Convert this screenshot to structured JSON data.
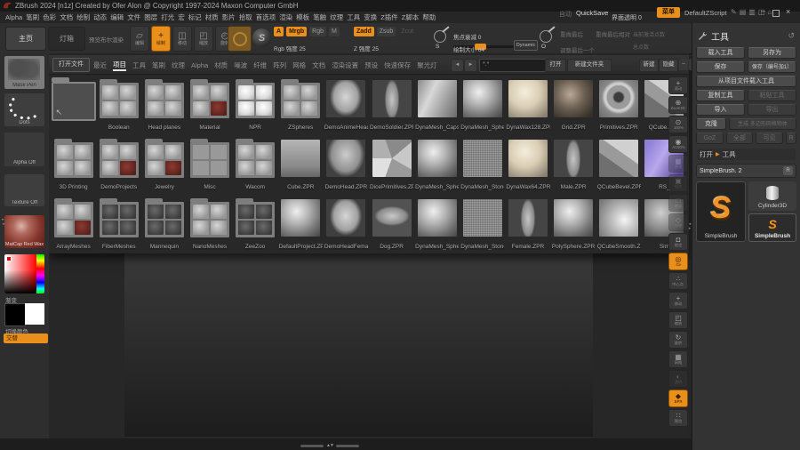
{
  "titlebar": {
    "title": "ZBrush 2024 [n1z] Created by Ofer Alon @ Copyright 1997-2024 Maxon Computer GmbH",
    "auto": "自动",
    "quicksave": "QuickSave",
    "opacity_label": "界面透明 0",
    "menu_btn": "菜单",
    "zscript_btn": "DefaultZScript",
    "icons": [
      "✎",
      "▤",
      "▥",
      "◫",
      "⌂"
    ],
    "minimize": "–",
    "close": "×"
  },
  "menubar": {
    "items": [
      "Alpha",
      "笔刷",
      "色彩",
      "文档",
      "绘制",
      "动态",
      "编辑",
      "文件",
      "图层",
      "打光",
      "宏",
      "标记",
      "材质",
      "影片",
      "拾取",
      "首选项",
      "渲染",
      "模板",
      "笔触",
      "纹理",
      "工具",
      "变换",
      "Z插件",
      "Z脚本",
      "帮助"
    ]
  },
  "topshelf": {
    "home": "主页",
    "lightbox": "灯箱",
    "preview": "预览布尔渲染",
    "modes": [
      {
        "label": "编辑",
        "glyph": "▱",
        "active": false
      },
      {
        "label": "绘制",
        "glyph": "+",
        "active": true
      },
      {
        "label": "移动",
        "glyph": "◫",
        "active": false
      },
      {
        "label": "缩放",
        "glyph": "◰",
        "active": false
      },
      {
        "label": "旋转",
        "glyph": "◴",
        "active": false
      }
    ],
    "brush_s": "S",
    "brush_o": "O",
    "paint": [
      {
        "label": "A",
        "on": true
      },
      {
        "label": "Mrgb",
        "on": true
      },
      {
        "label": "Rgb",
        "on": false
      },
      {
        "label": "M",
        "on": false
      }
    ],
    "rgb_slider": {
      "label": "Rgb 强度 25",
      "pos": 45
    },
    "sculpt": [
      {
        "label": "Zadd",
        "on": true
      },
      {
        "label": "Zsub",
        "on": false
      },
      {
        "label": "Zcut",
        "on": false,
        "disabled": true
      }
    ],
    "z_slider": {
      "label": "Z 强度 25",
      "pos": 78
    },
    "focal_slider": {
      "label": "焦点衰减 0",
      "pos": 38
    },
    "size_slider": {
      "label": "绘制大小 64",
      "pos": 18
    },
    "dynamic": "Dynamic",
    "replay": "重做最后",
    "replay_rel": "重做最后相对",
    "adjust_slider": {
      "label": "调整最后一个",
      "pos": 62
    },
    "active_points": "当前激活点数",
    "total_points": "总点数"
  },
  "leftshelf": {
    "brush": "Mask Pen",
    "stroke": "Dots",
    "alpha": "Alpha Off",
    "texture": "Texture Off",
    "material": "MatCap Red Wax",
    "gradient": "渐变",
    "switch_color": "切换颜色",
    "alternate": "交替"
  },
  "lightbox": {
    "open_file": "打开文件",
    "tabs": [
      {
        "label": "最近",
        "active": false
      },
      {
        "label": "项目",
        "active": true
      },
      {
        "label": "工具",
        "active": false
      },
      {
        "label": "笔刷",
        "active": false
      },
      {
        "label": "纹理",
        "active": false
      },
      {
        "label": "Alpha",
        "active": false
      },
      {
        "label": "材质",
        "active": false
      },
      {
        "label": "噪波",
        "active": false
      },
      {
        "label": "纤维",
        "active": false
      },
      {
        "label": "阵列",
        "active": false
      },
      {
        "label": "网格",
        "active": false
      },
      {
        "label": "文档",
        "active": false
      },
      {
        "label": "渲染设置",
        "active": false
      },
      {
        "label": "预设",
        "active": false
      },
      {
        "label": "快速保存",
        "active": false
      },
      {
        "label": "聚光灯",
        "active": false
      }
    ],
    "prev": "◄",
    "next": "►",
    "filter": "*.*",
    "open": "打开",
    "new_folder": "新建文件夹",
    "new_btn": "新建",
    "hide_btn": "隐藏",
    "view_icons": [
      "–",
      "=",
      "≡",
      "≣"
    ],
    "rows": [
      [
        {
          "label": "",
          "kind": "up"
        },
        {
          "label": "Boolean",
          "kind": "folder"
        },
        {
          "label": "Head planes",
          "kind": "folder"
        },
        {
          "label": "Material",
          "kind": "folder-red"
        },
        {
          "label": "NPR",
          "kind": "folder-light"
        },
        {
          "label": "ZSpheres",
          "kind": "folder"
        },
        {
          "label": "DemoAnimeHead",
          "kind": "head"
        },
        {
          "label": "DemoSoldier.ZPR",
          "kind": "figure"
        },
        {
          "label": "DynaMesh_Capsule",
          "kind": "capsule"
        },
        {
          "label": "DynaMesh_Sphere",
          "kind": "sphere"
        },
        {
          "label": "DynaWax128.ZPR",
          "kind": "wax"
        },
        {
          "label": "Grid.ZPR",
          "kind": "grid-sphere"
        },
        {
          "label": "Primitives.ZPR",
          "kind": "torus"
        },
        {
          "label": "QCube.ZPR",
          "kind": "cube"
        }
      ],
      [
        {
          "label": "3D Printing",
          "kind": "folder"
        },
        {
          "label": "DemoProjects",
          "kind": "folder-red"
        },
        {
          "label": "Jewelry",
          "kind": "folder-red"
        },
        {
          "label": "Misc",
          "kind": "folder-empty"
        },
        {
          "label": "Wacom",
          "kind": "folder"
        },
        {
          "label": "Cube.ZPR",
          "kind": "cube-flat"
        },
        {
          "label": "DemoHead.ZPR",
          "kind": "bust"
        },
        {
          "label": "DicePrimitives.ZPR",
          "kind": "icosa"
        },
        {
          "label": "DynaMesh_Sphere",
          "kind": "sphere"
        },
        {
          "label": "DynaMesh_Stone",
          "kind": "stone"
        },
        {
          "label": "DynaWax64.ZPR",
          "kind": "wax"
        },
        {
          "label": "Male.ZPR",
          "kind": "figure"
        },
        {
          "label": "QCubeBevel.ZPR",
          "kind": "cube"
        },
        {
          "label": "RS_",
          "kind": "purple"
        }
      ],
      [
        {
          "label": "ArrayMeshes",
          "kind": "folder-red"
        },
        {
          "label": "FiberMeshes",
          "kind": "folder-dark"
        },
        {
          "label": "Mannequin",
          "kind": "folder-dark"
        },
        {
          "label": "NanoMeshes",
          "kind": "folder"
        },
        {
          "label": "ZeeZoo",
          "kind": "folder-dark"
        },
        {
          "label": "DefaultProject.ZPR",
          "kind": "sphere"
        },
        {
          "label": "DemoHeadFemale",
          "kind": "head"
        },
        {
          "label": "Dog.ZPR",
          "kind": "dog"
        },
        {
          "label": "DynaMesh_Sphere",
          "kind": "sphere"
        },
        {
          "label": "DynaMesh_Stone",
          "kind": "stone"
        },
        {
          "label": "Female.ZPR",
          "kind": "figure"
        },
        {
          "label": "PolySphere.ZPR",
          "kind": "sphere"
        },
        {
          "label": "QCubeSmooth.ZPR",
          "kind": "cube-smooth"
        },
        {
          "label": "Sim",
          "kind": "sphere-dark"
        }
      ]
    ]
  },
  "right_shelf": [
    {
      "name": "scroll",
      "glyph": "+",
      "label": "滚动"
    },
    {
      "name": "zoom3d",
      "glyph": "⊕",
      "label": "Zoom3D"
    },
    {
      "name": "actual-size",
      "glyph": "⊙",
      "label": "100%"
    },
    {
      "name": "aa-half",
      "glyph": "◉",
      "label": "AC50%"
    },
    {
      "name": "perspective",
      "glyph": "▦",
      "label": "透视",
      "dim": true
    },
    {
      "name": "frame",
      "glyph": "▣",
      "label": "帧合",
      "dim": true
    },
    {
      "name": "floor",
      "glyph": "□",
      "label": "地面",
      "dim": true
    },
    {
      "name": "local-symmetry",
      "glyph": "◇",
      "label": "对称",
      "dim": true
    },
    {
      "name": "lock",
      "glyph": "◘",
      "label": "锁定"
    },
    {
      "name": "gizmo",
      "glyph": "◎",
      "label": "Gv",
      "orange": true
    },
    {
      "name": "pivot",
      "glyph": "∴",
      "label": "中心点"
    },
    {
      "name": "move",
      "glyph": "+",
      "label": "移动"
    },
    {
      "name": "scale",
      "glyph": "◰",
      "label": "缩放"
    },
    {
      "name": "rotate",
      "glyph": "↻",
      "label": "旋转"
    },
    {
      "name": "polyframe",
      "glyph": "▦",
      "label": "网格"
    },
    {
      "name": "transparency",
      "glyph": "◐",
      "label": "透明",
      "dim": true
    },
    {
      "name": "bpr-render",
      "glyph": "◆",
      "label": "BPR",
      "orange": true
    },
    {
      "name": "preview-dots",
      "glyph": "∷",
      "label": "预览"
    }
  ],
  "tool_palette": {
    "title": "工具",
    "load": "载入工具",
    "save_as": "另存为",
    "save": "保存",
    "save_inc": "保存（编号加1）",
    "load_from_project": "从项目文件载入工具",
    "copy": "复制工具",
    "paste": "粘贴工具",
    "import_btn": "导入",
    "export_btn": "导出",
    "clone": "克隆",
    "make_polymesh": "生成 多边形网格物体",
    "goz": "GoZ",
    "all": "全部",
    "visible": "可见",
    "r": "R",
    "section_open": "打开",
    "section_arrow": "▶",
    "section_tool": "工具",
    "current": "SimpleBrush. 2",
    "current_r": "R",
    "logo": "S",
    "thumb_main": "SimpleBrush",
    "thumb_alt": "Cylinder3D",
    "thumb_small": "SimpleBrush"
  },
  "bottom": {
    "arrows": "▲▼"
  },
  "colors": {
    "accent": "#e98f1c",
    "background": "#262626",
    "panel": "#333333"
  }
}
